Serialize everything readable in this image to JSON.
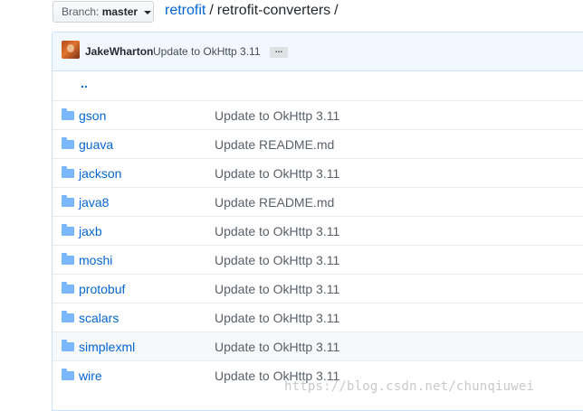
{
  "branch": {
    "label": "Branch:",
    "value": "master"
  },
  "breadcrumb": {
    "repo": "retrofit",
    "separator": "/",
    "current": "retrofit-converters",
    "trailing": "/"
  },
  "latest_commit": {
    "author": "JakeWharton",
    "message": "Update to OkHttp 3.11",
    "ellipsis": "..."
  },
  "parent_dir": "..",
  "files": [
    {
      "name": "gson",
      "message": "Update to OkHttp 3.11"
    },
    {
      "name": "guava",
      "message": "Update README.md"
    },
    {
      "name": "jackson",
      "message": "Update to OkHttp 3.11"
    },
    {
      "name": "java8",
      "message": "Update README.md"
    },
    {
      "name": "jaxb",
      "message": "Update to OkHttp 3.11"
    },
    {
      "name": "moshi",
      "message": "Update to OkHttp 3.11"
    },
    {
      "name": "protobuf",
      "message": "Update to OkHttp 3.11"
    },
    {
      "name": "scalars",
      "message": "Update to OkHttp 3.11"
    },
    {
      "name": "simplexml",
      "message": "Update to OkHttp 3.11"
    },
    {
      "name": "wire",
      "message": "Update to OkHttp 3.11"
    }
  ],
  "watermark": "https://blog.csdn.net/chunqiuwei",
  "colors": {
    "link": "#0366d6",
    "folder": "#79b8ff",
    "commit_bg": "#f1f8ff",
    "border": "#c8e1ff"
  },
  "icons": {
    "folder": "folder-icon",
    "caret": "caret-down-icon",
    "avatar": "user-avatar"
  }
}
